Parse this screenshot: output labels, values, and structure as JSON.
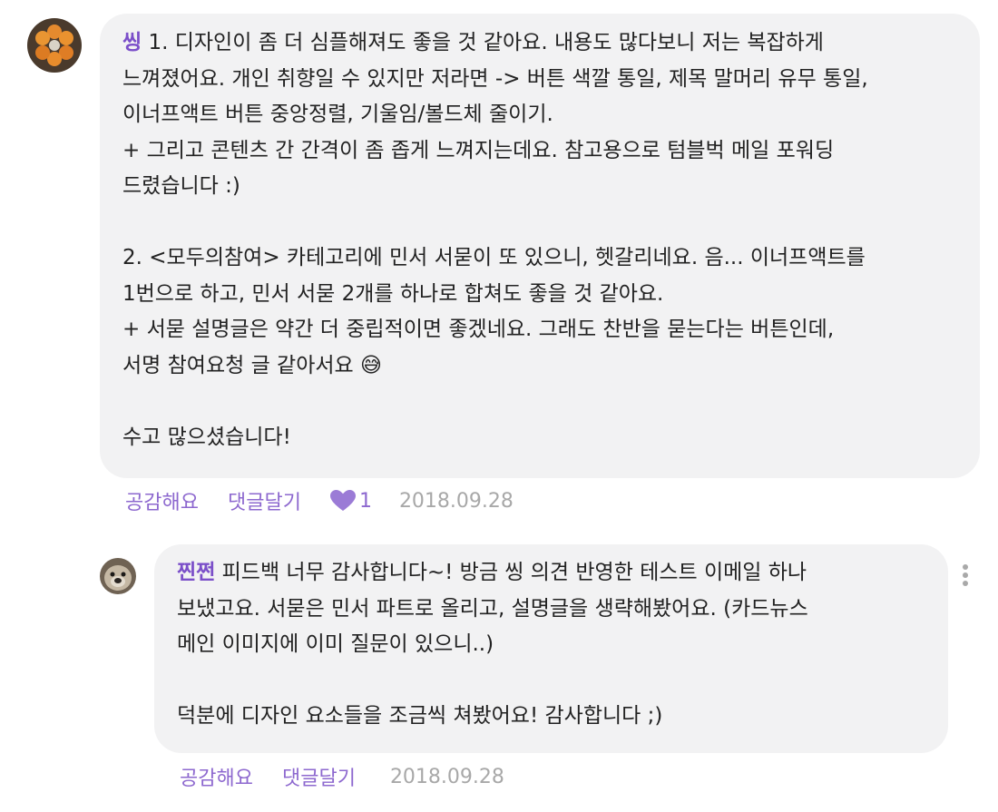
{
  "comment": {
    "author": "씽",
    "body": " 1. 디자인이 좀 더 심플해져도 좋을 것 같아요. 내용도 많다보니 저는 복잡하게\n느껴졌어요. 개인 취향일 수 있지만 저라면 -> 버튼 색깔 통일, 제목 말머리 유무 통일,\n이너프액트 버튼 중앙정렬, 기울임/볼드체 줄이기.\n+ 그리고 콘텐츠 간 간격이 좀 좁게 느껴지는데요. 참고용으로 텀블벅 메일 포워딩\n드렸습니다 :)\n\n2. <모두의참여> 카테고리에 민서 서묻이 또 있으니, 헷갈리네요. 음... 이너프액트를\n1번으로 하고, 민서 서묻 2개를 하나로 합쳐도 좋을 것 같아요.\n+ 서묻 설명글은 약간 더 중립적이면 좋겠네요. 그래도 찬반을 묻는다는 버튼인데,\n서명 참여요청 글 같아서요 😅\n\n수고 많으셨습니다!",
    "like_label": "공감해요",
    "reply_label": "댓글달기",
    "like_count": "1",
    "date": "2018.09.28"
  },
  "reply": {
    "author": "찐쩐",
    "body": " 피드백 너무 감사합니다~! 방금 씽 의견 반영한 테스트 이메일 하나\n보냈고요. 서묻은 민서 파트로 올리고, 설명글을 생략해봤어요. (카드뉴스\n메인 이미지에 이미 질문이 있으니..)\n\n덕분에 디자인 요소들을 조금씩 쳐봤어요! 감사합니다 ;)",
    "like_label": "공감해요",
    "reply_label": "댓글달기",
    "date": "2018.09.28"
  },
  "icons": {
    "heart": "heart-icon",
    "more": "more-vertical-icon"
  },
  "colors": {
    "author": "#7b4fc9",
    "action": "#8d68cf",
    "date": "#a8a8a8",
    "bubble": "#f2f2f3"
  }
}
